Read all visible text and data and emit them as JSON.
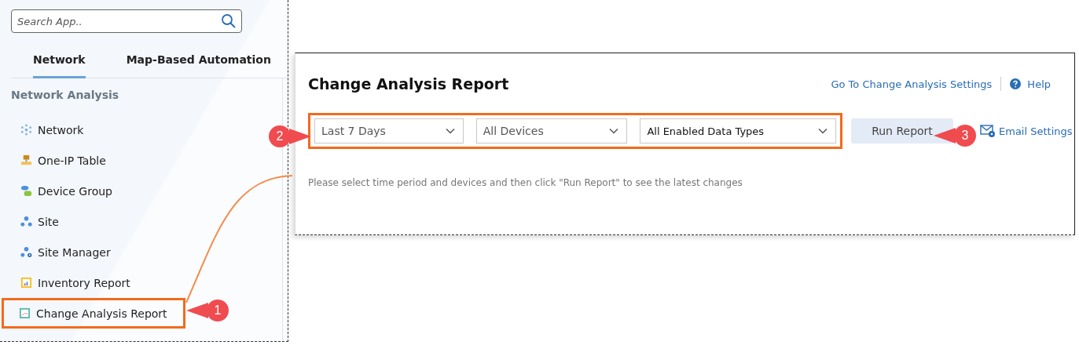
{
  "sidebar": {
    "search": {
      "placeholder": "Search App.."
    },
    "tabs": [
      {
        "label": "Network",
        "selected": true
      },
      {
        "label": "Map-Based Automation",
        "selected": false
      }
    ],
    "section_title": "Network Analysis",
    "items": [
      {
        "label": "Network",
        "highlighted": false
      },
      {
        "label": "One-IP Table",
        "highlighted": false
      },
      {
        "label": "Device Group",
        "highlighted": false
      },
      {
        "label": "Site",
        "highlighted": false
      },
      {
        "label": "Site Manager",
        "highlighted": false
      },
      {
        "label": "Inventory Report",
        "highlighted": false
      },
      {
        "label": "Change Analysis Report",
        "highlighted": true
      }
    ]
  },
  "report": {
    "title": "Change Analysis Report",
    "settings_link": "Go To Change Analysis Settings",
    "help_link": "Help",
    "filters": [
      {
        "value": "Last 7 Days"
      },
      {
        "value": "All Devices"
      },
      {
        "value": "All Enabled Data Types"
      }
    ],
    "run_button": "Run Report",
    "email_link": "Email Settings",
    "message": "Please select time period and devices and then click \"Run Report\" to see the latest changes"
  },
  "callouts": [
    {
      "number": "1"
    },
    {
      "number": "2"
    },
    {
      "number": "3"
    }
  ]
}
